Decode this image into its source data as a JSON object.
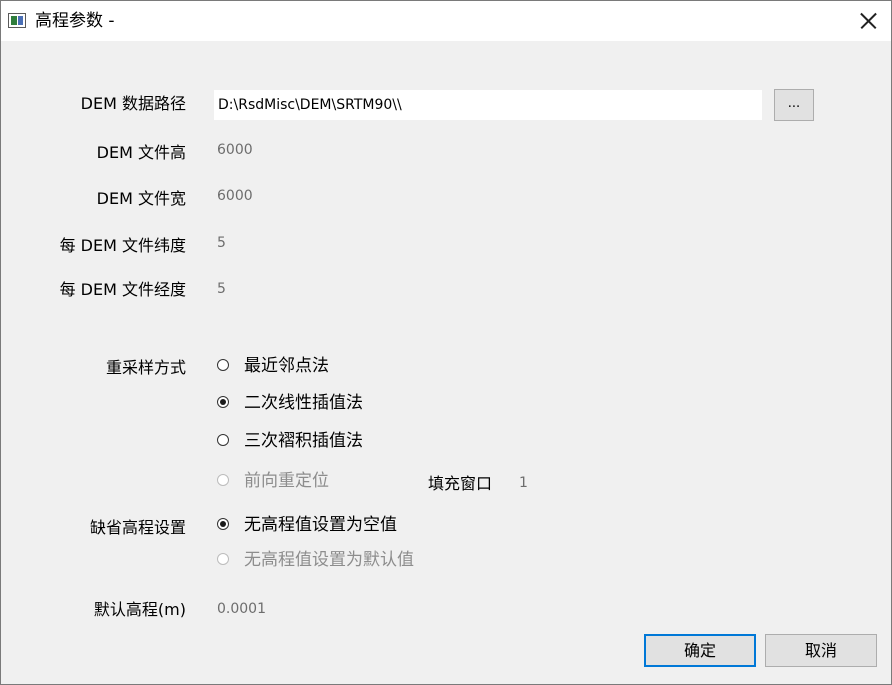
{
  "window": {
    "title": "高程参数 -",
    "icon": "app-window-icon",
    "close_icon": "close-icon"
  },
  "dem": {
    "path_label": "DEM 数据路径",
    "path_value": "D:\\RsdMisc\\DEM\\SRTM90\\\\",
    "browse_label": "...",
    "height_label": "DEM 文件高",
    "height_value": "6000",
    "width_label": "DEM 文件宽",
    "width_value": "6000",
    "lat_label": "每 DEM 文件纬度",
    "lat_value": "5",
    "lon_label": "每 DEM 文件经度",
    "lon_value": "5"
  },
  "resample": {
    "label": "重采样方式",
    "options": [
      {
        "label": "最近邻点法",
        "checked": false,
        "disabled": false
      },
      {
        "label": "二次线性插值法",
        "checked": true,
        "disabled": false
      },
      {
        "label": "三次褶积插值法",
        "checked": false,
        "disabled": false
      },
      {
        "label": "前向重定位",
        "checked": false,
        "disabled": true
      }
    ],
    "fill_window_label": "填充窗口",
    "fill_window_value": "1"
  },
  "missing": {
    "label": "缺省高程设置",
    "options": [
      {
        "label": "无高程值设置为空值",
        "checked": true,
        "disabled": false
      },
      {
        "label": "无高程值设置为默认值",
        "checked": false,
        "disabled": true
      }
    ]
  },
  "default_elevation": {
    "label": "默认高程(m)",
    "value": "0.0001"
  },
  "buttons": {
    "ok": "确定",
    "cancel": "取消"
  }
}
